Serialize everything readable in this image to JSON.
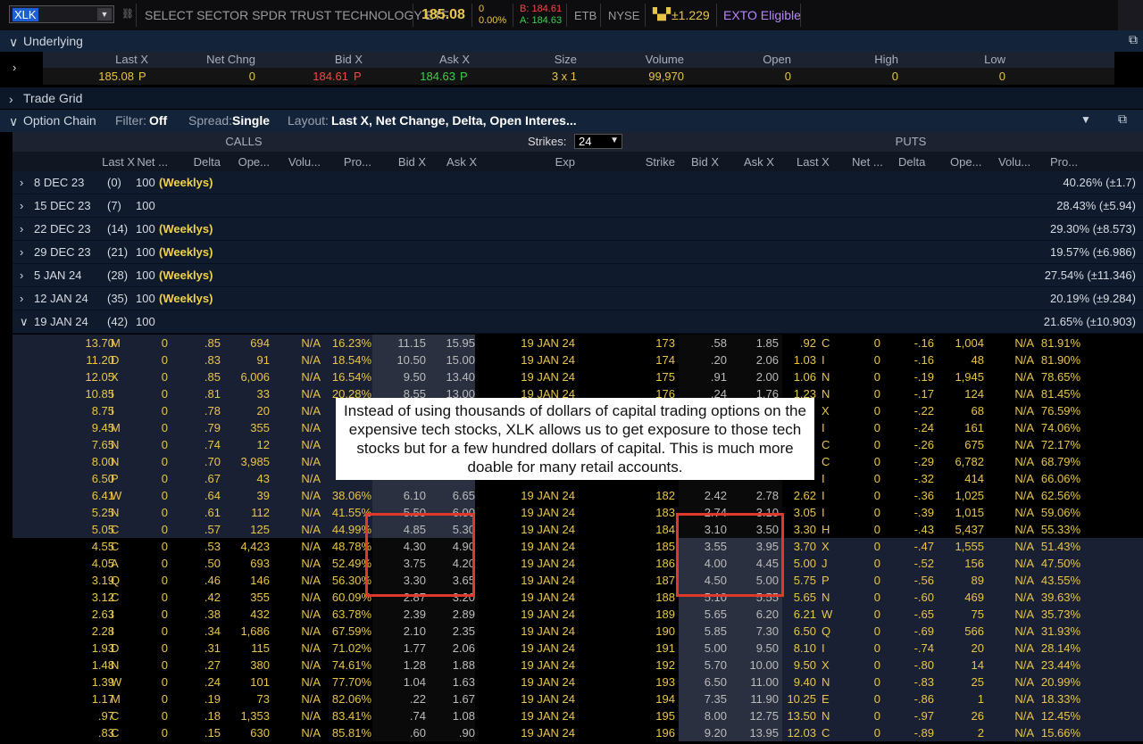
{
  "toolbar": {
    "symbol": "XLK",
    "description": "SELECT SECTOR SPDR TRUST TECHNOLOGY ETF",
    "last": "185.08",
    "change": "0",
    "change_pct": "0.00%",
    "bid": "B: 184.61",
    "ask": "A: 184.63",
    "etb": "ETB",
    "exchange": "NYSE",
    "move": "±1.229",
    "exto": "EXTO Eligible"
  },
  "underlying": {
    "title": "Underlying",
    "headers": [
      "Last X",
      "Net Chng",
      "Bid X",
      "Ask X",
      "Size",
      "Volume",
      "Open",
      "High",
      "Low"
    ],
    "values": {
      "last": "185.08",
      "last_ex": "P",
      "net": "0",
      "bid": "184.61",
      "bid_ex": "P",
      "ask": "184.63",
      "ask_ex": "P",
      "size": "3 x 1",
      "volume": "99,970",
      "open": "0",
      "high": "0",
      "low": "0"
    }
  },
  "trade_grid": {
    "title": "Trade Grid"
  },
  "option_chain": {
    "title": "Option Chain",
    "filter_label": "Filter:",
    "filter_value": "Off",
    "spread_label": "Spread:",
    "spread_value": "Single",
    "layout_label": "Layout:",
    "layout_value": "Last X, Net Change, Delta, Open Interes...",
    "calls": "CALLS",
    "puts": "PUTS",
    "strikes_label": "Strikes:",
    "strikes_value": "24",
    "call_headers": [
      "Last X",
      "Net ...",
      "Delta",
      "Ope...",
      "Volu...",
      "Pro...",
      "Bid X",
      "Ask X"
    ],
    "mid_headers": [
      "Exp",
      "Strike"
    ],
    "put_headers": [
      "Bid X",
      "Ask X",
      "Last X",
      "Net ...",
      "Delta",
      "Ope...",
      "Volu...",
      "Pro..."
    ]
  },
  "expirations": [
    {
      "date": "8 DEC 23",
      "days": "(0)",
      "mult": "100",
      "tag": "(Weeklys)",
      "iv": "40.26% (±1.7)"
    },
    {
      "date": "15 DEC 23",
      "days": "(7)",
      "mult": "100",
      "tag": "",
      "iv": "28.43% (±5.94)"
    },
    {
      "date": "22 DEC 23",
      "days": "(14)",
      "mult": "100",
      "tag": "(Weeklys)",
      "iv": "29.30% (±8.573)"
    },
    {
      "date": "29 DEC 23",
      "days": "(21)",
      "mult": "100",
      "tag": "(Weeklys)",
      "iv": "19.57% (±6.986)"
    },
    {
      "date": "5 JAN 24",
      "days": "(28)",
      "mult": "100",
      "tag": "(Weeklys)",
      "iv": "27.54% (±11.346)"
    },
    {
      "date": "12 JAN 24",
      "days": "(35)",
      "mult": "100",
      "tag": "(Weeklys)",
      "iv": "20.19% (±9.284)"
    },
    {
      "date": "19 JAN 24",
      "days": "(42)",
      "mult": "100",
      "tag": "",
      "iv": "21.65% (±10.903)"
    }
  ],
  "rows": [
    {
      "cl": "13.70",
      "cx": "M",
      "cn": "0",
      "cd": ".85",
      "co": "694",
      "cv": "N/A",
      "cp": "16.23%",
      "cb": "11.15",
      "ca": "15.95",
      "exp": "19 JAN 24",
      "k": "173",
      "pb": ".58",
      "pa": "1.85",
      "pl": ".92",
      "px": "C",
      "pn": "0",
      "pd": "-.16",
      "po": "1,004",
      "pv": "N/A",
      "pp": "81.91%"
    },
    {
      "cl": "11.20",
      "cx": "D",
      "cn": "0",
      "cd": ".83",
      "co": "91",
      "cv": "N/A",
      "cp": "18.54%",
      "cb": "10.50",
      "ca": "15.00",
      "exp": "19 JAN 24",
      "k": "174",
      "pb": ".20",
      "pa": "2.06",
      "pl": "1.03",
      "px": "I",
      "pn": "0",
      "pd": "-.16",
      "po": "48",
      "pv": "N/A",
      "pp": "81.90%"
    },
    {
      "cl": "12.05",
      "cx": "X",
      "cn": "0",
      "cd": ".85",
      "co": "6,006",
      "cv": "N/A",
      "cp": "16.54%",
      "cb": "9.50",
      "ca": "13.40",
      "exp": "19 JAN 24",
      "k": "175",
      "pb": ".91",
      "pa": "2.00",
      "pl": "1.06",
      "px": "N",
      "pn": "0",
      "pd": "-.19",
      "po": "1,945",
      "pv": "N/A",
      "pp": "78.65%"
    },
    {
      "cl": "10.85",
      "cx": "I",
      "cn": "0",
      "cd": ".81",
      "co": "33",
      "cv": "N/A",
      "cp": "20.28%",
      "cb": "8.55",
      "ca": "13.00",
      "exp": "19 JAN 24",
      "k": "176",
      "pb": ".24",
      "pa": "1.76",
      "pl": "1.23",
      "px": "N",
      "pn": "0",
      "pd": "-.17",
      "po": "124",
      "pv": "N/A",
      "pp": "81.45%"
    },
    {
      "cl": "8.75",
      "cx": "I",
      "cn": "0",
      "cd": ".78",
      "co": "20",
      "cv": "N/A",
      "cp": "2",
      "cb": "",
      "ca": "",
      "exp": "",
      "k": "",
      "pb": "",
      "pa": "",
      "pl": "",
      "px": "X",
      "pn": "0",
      "pd": "-.22",
      "po": "68",
      "pv": "N/A",
      "pp": "76.59%"
    },
    {
      "cl": "9.45",
      "cx": "M",
      "cn": "0",
      "cd": ".79",
      "co": "355",
      "cv": "N/A",
      "cp": "2",
      "cb": "",
      "ca": "",
      "exp": "",
      "k": "",
      "pb": "",
      "pa": "",
      "pl": "",
      "px": "I",
      "pn": "0",
      "pd": "-.24",
      "po": "161",
      "pv": "N/A",
      "pp": "74.06%"
    },
    {
      "cl": "7.65",
      "cx": "N",
      "cn": "0",
      "cd": ".74",
      "co": "12",
      "cv": "N/A",
      "cp": "2",
      "cb": "",
      "ca": "",
      "exp": "",
      "k": "",
      "pb": "",
      "pa": "",
      "pl": "",
      "px": "C",
      "pn": "0",
      "pd": "-.26",
      "po": "675",
      "pv": "N/A",
      "pp": "72.17%"
    },
    {
      "cl": "8.00",
      "cx": "N",
      "cn": "0",
      "cd": ".70",
      "co": "3,985",
      "cv": "N/A",
      "cp": "3",
      "cb": "",
      "ca": "",
      "exp": "",
      "k": "",
      "pb": "",
      "pa": "",
      "pl": "",
      "px": "C",
      "pn": "0",
      "pd": "-.29",
      "po": "6,782",
      "pv": "N/A",
      "pp": "68.79%"
    },
    {
      "cl": "6.50",
      "cx": "P",
      "cn": "0",
      "cd": ".67",
      "co": "43",
      "cv": "N/A",
      "cp": "",
      "cb": "",
      "ca": "",
      "exp": "",
      "k": "",
      "pb": "",
      "pa": "",
      "pl": "",
      "px": "I",
      "pn": "0",
      "pd": "-.32",
      "po": "414",
      "pv": "N/A",
      "pp": "66.06%"
    },
    {
      "cl": "6.41",
      "cx": "W",
      "cn": "0",
      "cd": ".64",
      "co": "39",
      "cv": "N/A",
      "cp": "38.06%",
      "cb": "6.10",
      "ca": "6.65",
      "exp": "19 JAN 24",
      "k": "182",
      "pb": "2.42",
      "pa": "2.78",
      "pl": "2.62",
      "px": "I",
      "pn": "0",
      "pd": "-.36",
      "po": "1,025",
      "pv": "N/A",
      "pp": "62.56%"
    },
    {
      "cl": "5.25",
      "cx": "N",
      "cn": "0",
      "cd": ".61",
      "co": "112",
      "cv": "N/A",
      "cp": "41.55%",
      "cb": "5.50",
      "ca": "6.00",
      "exp": "19 JAN 24",
      "k": "183",
      "pb": "2.74",
      "pa": "3.10",
      "pl": "3.05",
      "px": "I",
      "pn": "0",
      "pd": "-.39",
      "po": "1,015",
      "pv": "N/A",
      "pp": "59.06%"
    },
    {
      "cl": "5.05",
      "cx": "C",
      "cn": "0",
      "cd": ".57",
      "co": "125",
      "cv": "N/A",
      "cp": "44.99%",
      "cb": "4.85",
      "ca": "5.30",
      "exp": "19 JAN 24",
      "k": "184",
      "pb": "3.10",
      "pa": "3.50",
      "pl": "3.30",
      "px": "H",
      "pn": "0",
      "pd": "-.43",
      "po": "5,437",
      "pv": "N/A",
      "pp": "55.33%"
    },
    {
      "cl": "4.55",
      "cx": "C",
      "cn": "0",
      "cd": ".53",
      "co": "4,423",
      "cv": "N/A",
      "cp": "48.78%",
      "cb": "4.30",
      "ca": "4.90",
      "exp": "19 JAN 24",
      "k": "185",
      "pb": "3.55",
      "pa": "3.95",
      "pl": "3.70",
      "px": "X",
      "pn": "0",
      "pd": "-.47",
      "po": "1,555",
      "pv": "N/A",
      "pp": "51.43%"
    },
    {
      "cl": "4.05",
      "cx": "A",
      "cn": "0",
      "cd": ".50",
      "co": "693",
      "cv": "N/A",
      "cp": "52.49%",
      "cb": "3.75",
      "ca": "4.20",
      "exp": "19 JAN 24",
      "k": "186",
      "pb": "4.00",
      "pa": "4.45",
      "pl": "5.00",
      "px": "J",
      "pn": "0",
      "pd": "-.52",
      "po": "156",
      "pv": "N/A",
      "pp": "47.50%"
    },
    {
      "cl": "3.19",
      "cx": "Q",
      "cn": "0",
      "cd": ".46",
      "co": "146",
      "cv": "N/A",
      "cp": "56.30%",
      "cb": "3.30",
      "ca": "3.65",
      "exp": "19 JAN 24",
      "k": "187",
      "pb": "4.50",
      "pa": "5.00",
      "pl": "5.75",
      "px": "P",
      "pn": "0",
      "pd": "-.56",
      "po": "89",
      "pv": "N/A",
      "pp": "43.55%"
    },
    {
      "cl": "3.12",
      "cx": "C",
      "cn": "0",
      "cd": ".42",
      "co": "355",
      "cv": "N/A",
      "cp": "60.09%",
      "cb": "2.87",
      "ca": "3.20",
      "exp": "19 JAN 24",
      "k": "188",
      "pb": "5.10",
      "pa": "5.55",
      "pl": "5.65",
      "px": "N",
      "pn": "0",
      "pd": "-.60",
      "po": "469",
      "pv": "N/A",
      "pp": "39.63%"
    },
    {
      "cl": "2.63",
      "cx": "I",
      "cn": "0",
      "cd": ".38",
      "co": "432",
      "cv": "N/A",
      "cp": "63.78%",
      "cb": "2.39",
      "ca": "2.89",
      "exp": "19 JAN 24",
      "k": "189",
      "pb": "5.65",
      "pa": "6.20",
      "pl": "6.21",
      "px": "W",
      "pn": "0",
      "pd": "-.65",
      "po": "75",
      "pv": "N/A",
      "pp": "35.73%"
    },
    {
      "cl": "2.28",
      "cx": "I",
      "cn": "0",
      "cd": ".34",
      "co": "1,686",
      "cv": "N/A",
      "cp": "67.59%",
      "cb": "2.10",
      "ca": "2.35",
      "exp": "19 JAN 24",
      "k": "190",
      "pb": "5.85",
      "pa": "7.30",
      "pl": "6.50",
      "px": "Q",
      "pn": "0",
      "pd": "-.69",
      "po": "566",
      "pv": "N/A",
      "pp": "31.93%"
    },
    {
      "cl": "1.93",
      "cx": "D",
      "cn": "0",
      "cd": ".31",
      "co": "115",
      "cv": "N/A",
      "cp": "71.02%",
      "cb": "1.77",
      "ca": "2.06",
      "exp": "19 JAN 24",
      "k": "191",
      "pb": "5.00",
      "pa": "9.50",
      "pl": "8.10",
      "px": "I",
      "pn": "0",
      "pd": "-.74",
      "po": "20",
      "pv": "N/A",
      "pp": "28.14%"
    },
    {
      "cl": "1.48",
      "cx": "N",
      "cn": "0",
      "cd": ".27",
      "co": "380",
      "cv": "N/A",
      "cp": "74.61%",
      "cb": "1.28",
      "ca": "1.88",
      "exp": "19 JAN 24",
      "k": "192",
      "pb": "5.70",
      "pa": "10.00",
      "pl": "9.50",
      "px": "X",
      "pn": "0",
      "pd": "-.80",
      "po": "14",
      "pv": "N/A",
      "pp": "23.44%"
    },
    {
      "cl": "1.39",
      "cx": "W",
      "cn": "0",
      "cd": ".24",
      "co": "101",
      "cv": "N/A",
      "cp": "77.70%",
      "cb": "1.04",
      "ca": "1.63",
      "exp": "19 JAN 24",
      "k": "193",
      "pb": "6.50",
      "pa": "11.00",
      "pl": "9.40",
      "px": "N",
      "pn": "0",
      "pd": "-.83",
      "po": "25",
      "pv": "N/A",
      "pp": "20.99%"
    },
    {
      "cl": "1.17",
      "cx": "M",
      "cn": "0",
      "cd": ".19",
      "co": "73",
      "cv": "N/A",
      "cp": "82.06%",
      "cb": ".22",
      "ca": "1.67",
      "exp": "19 JAN 24",
      "k": "194",
      "pb": "7.35",
      "pa": "11.90",
      "pl": "10.25",
      "px": "E",
      "pn": "0",
      "pd": "-.86",
      "po": "1",
      "pv": "N/A",
      "pp": "18.33%"
    },
    {
      "cl": ".97",
      "cx": "C",
      "cn": "0",
      "cd": ".18",
      "co": "1,353",
      "cv": "N/A",
      "cp": "83.41%",
      "cb": ".74",
      "ca": "1.08",
      "exp": "19 JAN 24",
      "k": "195",
      "pb": "8.00",
      "pa": "12.75",
      "pl": "13.50",
      "px": "N",
      "pn": "0",
      "pd": "-.97",
      "po": "26",
      "pv": "N/A",
      "pp": "12.45%"
    },
    {
      "cl": ".83",
      "cx": "C",
      "cn": "0",
      "cd": ".15",
      "co": "630",
      "cv": "N/A",
      "cp": "85.81%",
      "cb": ".60",
      "ca": ".90",
      "exp": "19 JAN 24",
      "k": "196",
      "pb": "9.20",
      "pa": "13.95",
      "pl": "12.03",
      "px": "C",
      "pn": "0",
      "pd": "-.89",
      "po": "2",
      "pv": "N/A",
      "pp": "15.66%"
    }
  ],
  "annotation": "Instead of using thousands of dollars of capital trading options on the expensive tech stocks, XLK allows us to get exposure to those tech stocks but for a few hundred dollars of capital. This is much more doable for many retail accounts.",
  "colors": {
    "accent_yellow": "#e8c547",
    "bid_red": "#ff4444",
    "ask_green": "#3ecf4a",
    "itm_bg": "#1a2033",
    "highlight_red": "#e0382b"
  }
}
